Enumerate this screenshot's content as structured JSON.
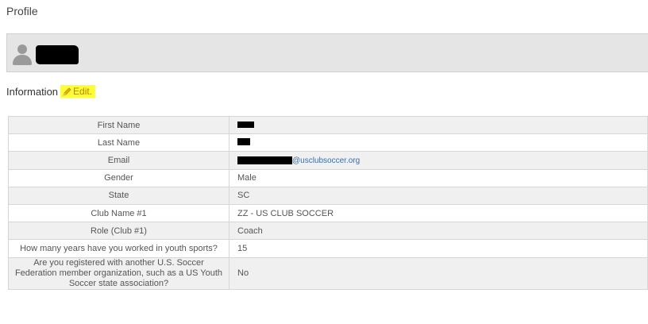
{
  "page": {
    "title": "Profile"
  },
  "profile": {
    "name": ""
  },
  "information": {
    "heading": "Information",
    "edit_label": "Edit.",
    "rows": [
      {
        "label": "First Name",
        "value": ""
      },
      {
        "label": "Last Name",
        "value": ""
      },
      {
        "label": "Email",
        "value": "@usclubsoccer.org"
      },
      {
        "label": "Gender",
        "value": "Male"
      },
      {
        "label": "State",
        "value": "SC"
      },
      {
        "label": "Club Name #1",
        "value": "ZZ - US CLUB SOCCER"
      },
      {
        "label": "Role (Club #1)",
        "value": "Coach"
      },
      {
        "label": "How many years have you worked in youth sports?",
        "value": "15"
      },
      {
        "label": "Are you registered with another U.S. Soccer Federation member organization, such as a US Youth Soccer state association?",
        "value": "No"
      }
    ]
  },
  "colors": {
    "edit_highlight": "#ffff33",
    "link": "#3a6ea5",
    "profile_bar": "#e5e5e5"
  },
  "icons": {
    "avatar": "user-silhouette-icon",
    "edit": "pencil-icon"
  }
}
